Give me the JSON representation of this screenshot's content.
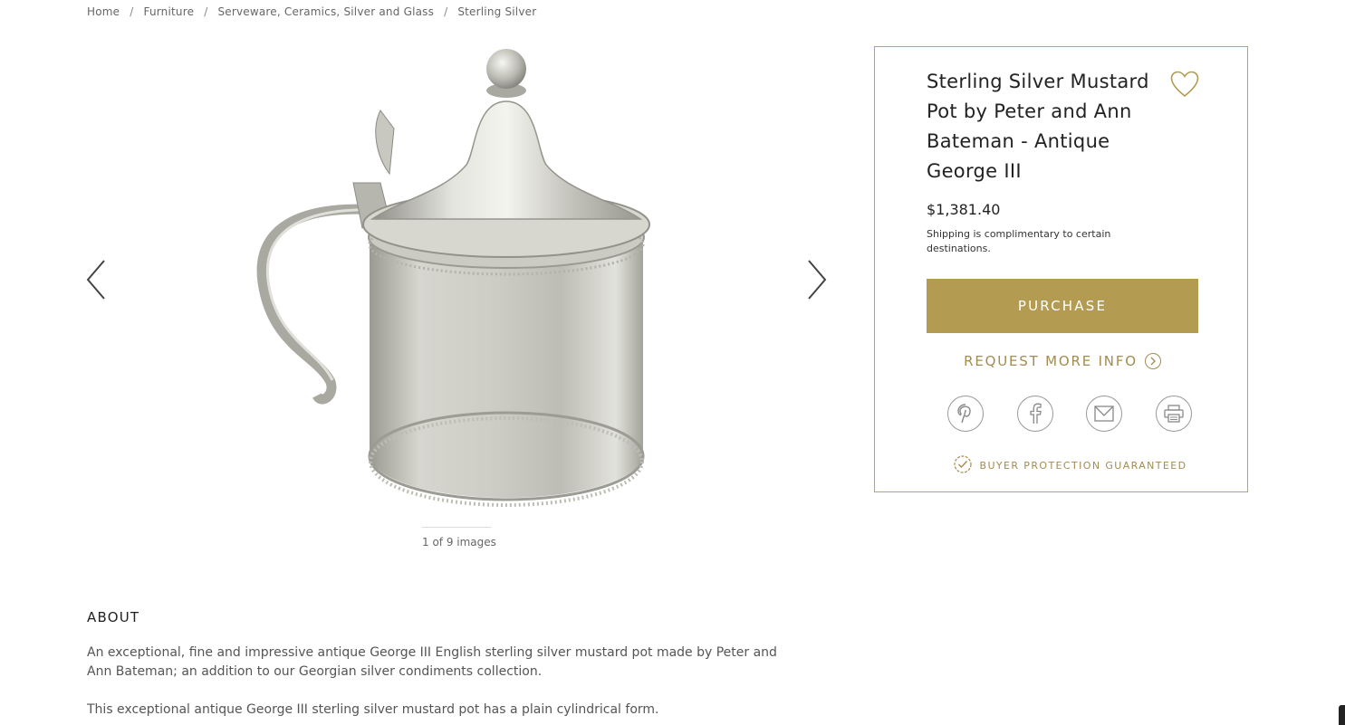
{
  "breadcrumb": {
    "items": [
      "Home",
      "Furniture",
      "Serveware, Ceramics, Silver and Glass",
      "Sterling Silver"
    ],
    "separator": "/"
  },
  "gallery": {
    "counter": "1 of 9 images",
    "prev_icon": "chevron-left-icon",
    "next_icon": "chevron-right-icon"
  },
  "product": {
    "title": "Sterling Silver Mustard Pot by Peter and Ann Bateman - Antique George III",
    "price": "$1,381.40",
    "shipping": "Shipping is complimentary to certain destinations.",
    "purchase_label": "PURCHASE",
    "request_label": "REQUEST MORE INFO",
    "protection_label": "BUYER PROTECTION GUARANTEED",
    "share_icons": [
      "pinterest-icon",
      "facebook-icon",
      "email-icon",
      "print-icon"
    ]
  },
  "about": {
    "heading": "ABOUT",
    "paragraph1": "An exceptional, fine and impressive antique George III English sterling silver mustard pot made by Peter and Ann Bateman; an addition to our Georgian silver condiments collection.",
    "paragraph2": "This exceptional antique George III sterling silver mustard pot has a plain cylindrical form."
  },
  "colors": {
    "accent": "#b39b51",
    "accent_text": "#a38c4f",
    "border": "#b9a265"
  }
}
